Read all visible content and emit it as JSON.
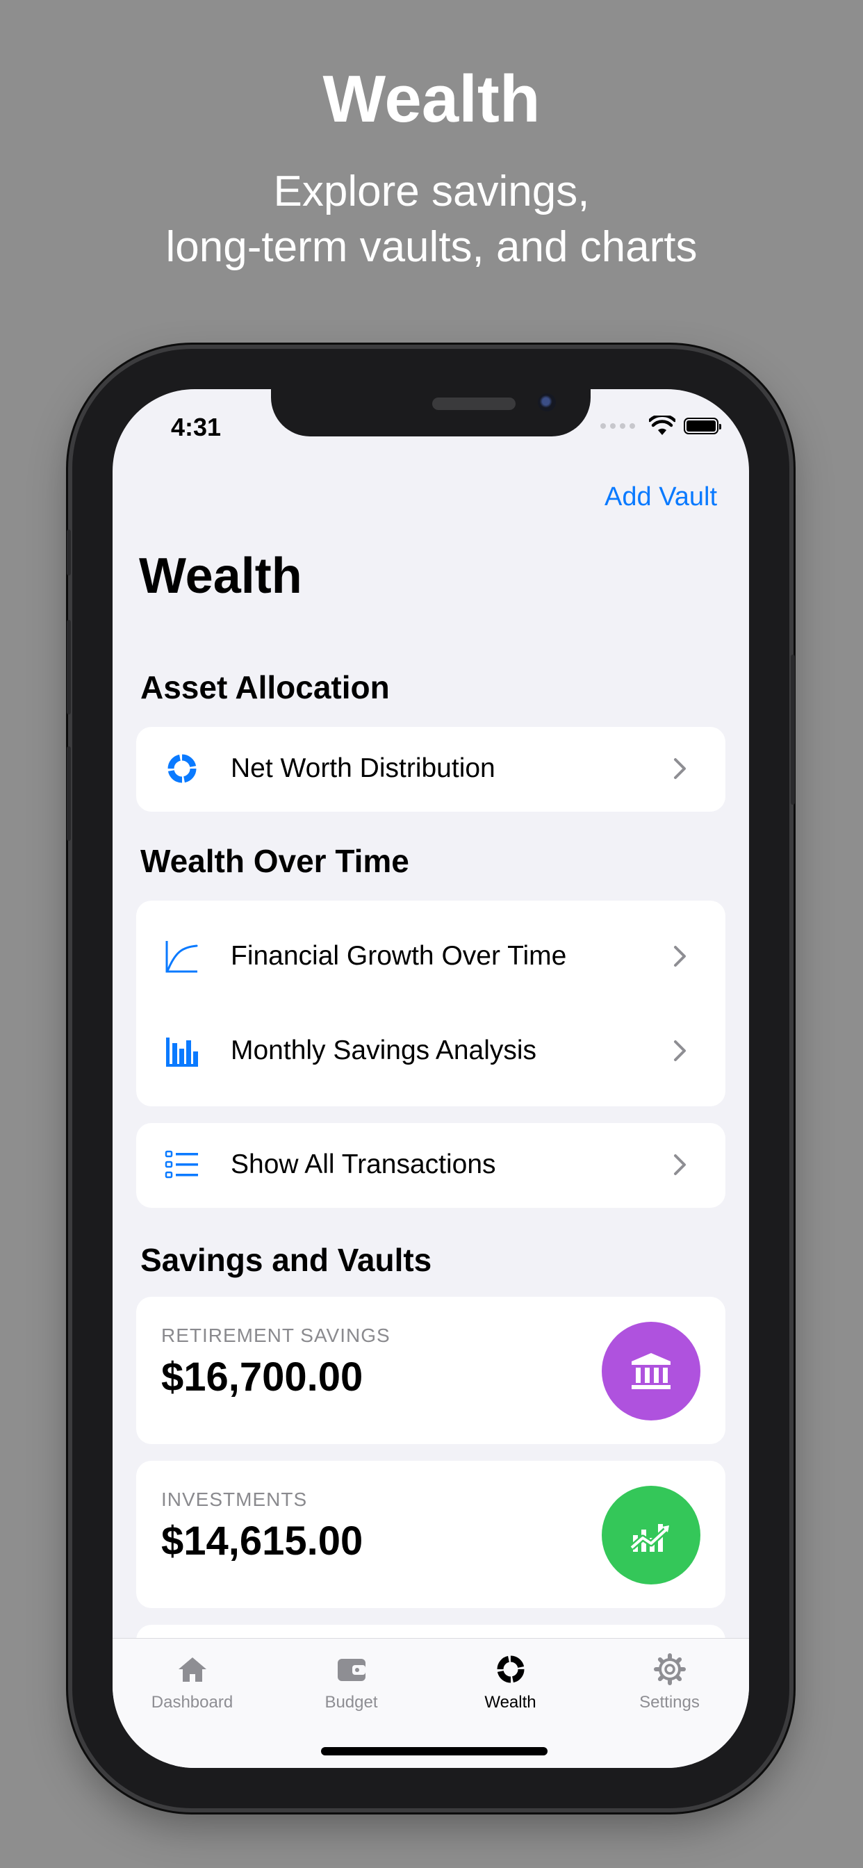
{
  "promo": {
    "title": "Wealth",
    "subtitle_line1": "Explore savings,",
    "subtitle_line2": "long-term vaults, and charts"
  },
  "status_bar": {
    "time": "4:31"
  },
  "nav": {
    "action_label": "Add Vault",
    "title": "Wealth"
  },
  "sections": {
    "asset_allocation": {
      "title": "Asset Allocation",
      "items": [
        {
          "label": "Net Worth Distribution",
          "icon": "donut-chart-icon"
        }
      ]
    },
    "wealth_over_time": {
      "title": "Wealth Over Time",
      "items": [
        {
          "label": "Financial Growth Over Time",
          "icon": "line-chart-icon"
        },
        {
          "label": "Monthly Savings Analysis",
          "icon": "bar-chart-icon"
        }
      ]
    },
    "transactions": {
      "items": [
        {
          "label": "Show All Transactions",
          "icon": "list-icon"
        }
      ]
    },
    "savings_vaults": {
      "title": "Savings and Vaults",
      "vaults": [
        {
          "label": "RETIREMENT SAVINGS",
          "amount": "$16,700.00",
          "icon": "bank-icon",
          "color": "#af52de"
        },
        {
          "label": "INVESTMENTS",
          "amount": "$14,615.00",
          "icon": "trending-chart-icon",
          "color": "#34c759"
        }
      ]
    }
  },
  "tab_bar": {
    "tabs": [
      {
        "label": "Dashboard",
        "icon": "house-icon",
        "active": false
      },
      {
        "label": "Budget",
        "icon": "wallet-icon",
        "active": false
      },
      {
        "label": "Wealth",
        "icon": "donut-chart-icon",
        "active": true
      },
      {
        "label": "Settings",
        "icon": "gear-icon",
        "active": false
      }
    ]
  },
  "colors": {
    "accent": "#0a7aff",
    "background": "#f2f2f7",
    "secondary_text": "#8e8e93"
  }
}
